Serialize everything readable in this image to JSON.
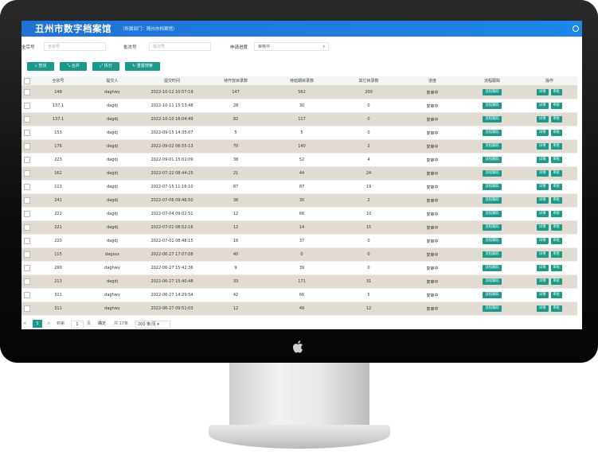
{
  "header": {
    "title": "丑州市数字档案馆",
    "subtitle": "（所属部门：随州市档案馆）"
  },
  "filters": {
    "quanzong_label": "全宗号",
    "quanzong_placeholder": "全宗号",
    "batch_label": "批次号",
    "batch_placeholder": "批次号",
    "progress_label": "申请进度",
    "progress_value": "审核中"
  },
  "toolbar": {
    "search": "查找",
    "merge": "合并",
    "split": "拆分",
    "reset": "重置搜索"
  },
  "table": {
    "columns": [
      "全宗号",
      "提交人",
      "提交时间",
      "待开放目录数",
      "待延期目录数",
      "其它目录数",
      "进度",
      "流程跟踪",
      "操作"
    ],
    "action_trace": "流程跟踪",
    "action_detail": "详情",
    "action_review": "审批",
    "rows": [
      [
        "148",
        "daghwy",
        "2022-10-12 10:57:19",
        "147",
        "562",
        "200",
        "复审中"
      ],
      [
        "137.1",
        "dagdj",
        "2022-10-11 15:13:48",
        "28",
        "30",
        "0",
        "复审中"
      ],
      [
        "137.1",
        "dagdj",
        "2022-10-10 16:04:49",
        "82",
        "117",
        "0",
        "复审中"
      ],
      [
        "153",
        "dagdj",
        "2022-09-15 14:35:07",
        "5",
        "5",
        "0",
        "复审中"
      ],
      [
        "176",
        "dagdj",
        "2022-09-02 06:55:13",
        "70",
        "140",
        "2",
        "复审中"
      ],
      [
        "223",
        "dagdj",
        "2022-09-01 15:02:09",
        "38",
        "52",
        "4",
        "复审中"
      ],
      [
        "162",
        "dagdj",
        "2022-07-22 08:44:25",
        "21",
        "44",
        "24",
        "复审中"
      ],
      [
        "113",
        "dagdj",
        "2022-07-15 11:16:10",
        "87",
        "87",
        "19",
        "复审中"
      ],
      [
        "241",
        "dagdj",
        "2022-07-06 09:46:50",
        "36",
        "30",
        "2",
        "复审中"
      ],
      [
        "222",
        "dagdj",
        "2022-07-04 09:02:51",
        "12",
        "66",
        "10",
        "复审中"
      ],
      [
        "221",
        "dagdj",
        "2022-07-01 08:52:16",
        "12",
        "14",
        "15",
        "复审中"
      ],
      [
        "220",
        "dagdj",
        "2022-07-01 08:48:15",
        "16",
        "37",
        "0",
        "复审中"
      ],
      [
        "115",
        "dagsxx",
        "2022-06-27 17:07:08",
        "40",
        "0",
        "0",
        "复审中"
      ],
      [
        "290",
        "daghwy",
        "2022-06-27 15:42:36",
        "9",
        "39",
        "0",
        "复审中"
      ],
      [
        "213",
        "dagdj",
        "2022-06-27 15:40:48",
        "33",
        "171",
        "31",
        "复审中"
      ],
      [
        "311",
        "daghwy",
        "2022-06-27 14:29:54",
        "42",
        "66",
        "5",
        "复审中"
      ],
      [
        "311",
        "daghwy",
        "2022-06-27 09:51:03",
        "12",
        "49",
        "12",
        "复审中"
      ]
    ]
  },
  "pager": {
    "prev": "<",
    "current": "1",
    "next": ">",
    "goto": "到第",
    "page_input": "1",
    "page_unit": "页",
    "confirm": "确定",
    "total": "共 17条",
    "page_size": "200 条/页"
  },
  "colors": {
    "topbar": "#1e73d6",
    "accent": "#1a9a8a",
    "row_alt": "#e2dbd2"
  }
}
